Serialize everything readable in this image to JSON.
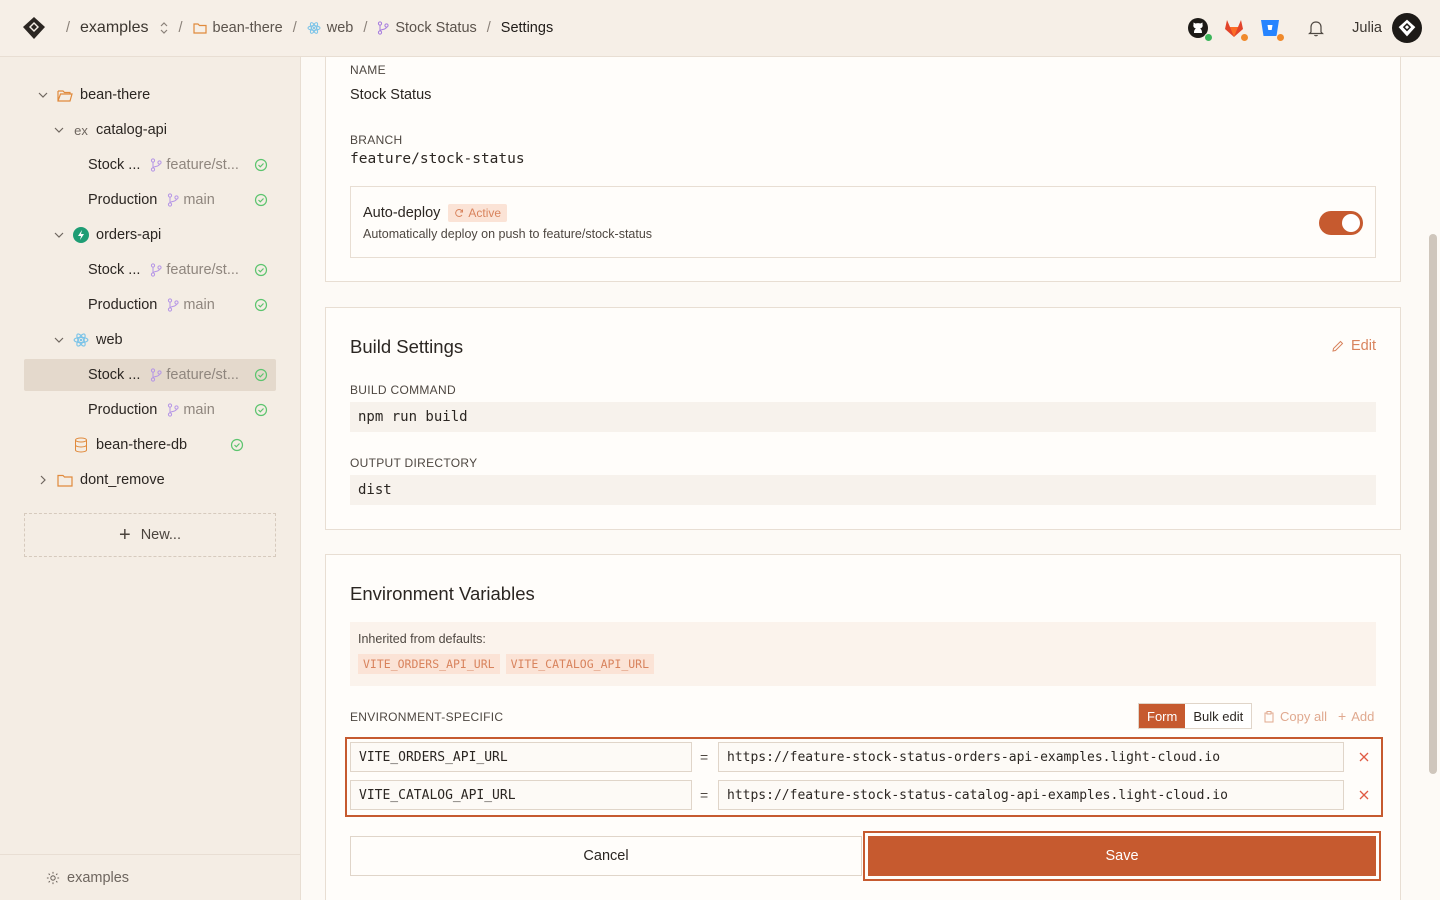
{
  "breadcrumb": {
    "workspace": "examples",
    "project": "bean-there",
    "service": "web",
    "environment": "Stock Status",
    "page": "Settings",
    "separator": "/"
  },
  "header": {
    "user_name": "Julia",
    "icons": [
      "github-icon",
      "gitlab-icon",
      "bitbucket-icon",
      "bell-icon"
    ],
    "status_colors": {
      "github": "#3bb55a",
      "gitlab": "#f08a2c",
      "bitbucket": "#f08a2c"
    }
  },
  "sidebar": {
    "project": "bean-there",
    "services": [
      {
        "name": "catalog-api",
        "icon": "ex-icon",
        "envs": [
          {
            "name": "Stock ...",
            "branch": "feature/st..."
          },
          {
            "name": "Production",
            "branch": "main"
          }
        ]
      },
      {
        "name": "orders-api",
        "icon": "bolt-icon",
        "envs": [
          {
            "name": "Stock ...",
            "branch": "feature/st..."
          },
          {
            "name": "Production",
            "branch": "main"
          }
        ]
      },
      {
        "name": "web",
        "icon": "react-icon",
        "envs": [
          {
            "name": "Stock ...",
            "branch": "feature/st..."
          },
          {
            "name": "Production",
            "branch": "main"
          }
        ]
      }
    ],
    "database": "bean-there-db",
    "other_folder": "dont_remove",
    "new_label": "New...",
    "footer_label": "examples"
  },
  "general": {
    "name_label": "NAME",
    "name_value": "Stock Status",
    "branch_label": "BRANCH",
    "branch_value": "feature/stock-status",
    "autodeploy_title": "Auto-deploy",
    "autodeploy_badge": "Active",
    "autodeploy_desc": "Automatically deploy on push to feature/stock-status",
    "autodeploy_on": true
  },
  "build": {
    "title": "Build Settings",
    "edit_label": "Edit",
    "command_label": "BUILD COMMAND",
    "command_value": "npm run build",
    "output_label": "OUTPUT DIRECTORY",
    "output_value": "dist"
  },
  "env": {
    "title": "Environment Variables",
    "inherited_label": "Inherited from defaults:",
    "inherited": [
      "VITE_ORDERS_API_URL",
      "VITE_CATALOG_API_URL"
    ],
    "specific_label": "ENVIRONMENT-SPECIFIC",
    "mode_form": "Form",
    "mode_bulk": "Bulk edit",
    "copy_all": "Copy all",
    "add": "Add",
    "vars": [
      {
        "key": "VITE_ORDERS_API_URL",
        "value": "https://feature-stock-status-orders-api-examples.light-cloud.io"
      },
      {
        "key": "VITE_CATALOG_API_URL",
        "value": "https://feature-stock-status-catalog-api-examples.light-cloud.io"
      }
    ],
    "equals": "=",
    "cancel_label": "Cancel",
    "save_label": "Save"
  },
  "colors": {
    "accent": "#c65a2f",
    "ok": "#5cc46e",
    "folder": "#e08a3c"
  }
}
